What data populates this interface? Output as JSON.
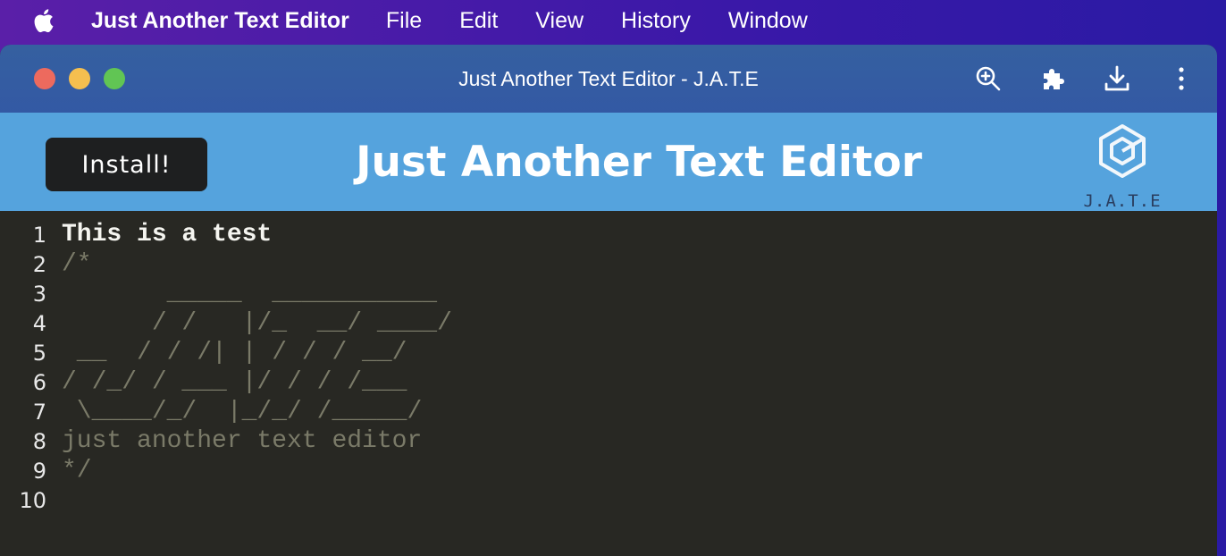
{
  "menubar": {
    "app_name": "Just Another Text Editor",
    "items": [
      "File",
      "Edit",
      "View",
      "History",
      "Window"
    ]
  },
  "window": {
    "title": "Just Another Text Editor - J.A.T.E",
    "toolbar_icons": [
      "zoom-in-icon",
      "extensions-icon",
      "download-icon",
      "more-vert-icon"
    ]
  },
  "header": {
    "install_label": "Install!",
    "title": "Just Another Text Editor",
    "logo_text": "J.A.T.E"
  },
  "editor": {
    "lines": [
      {
        "n": "1",
        "text": "This is a test"
      },
      {
        "n": "2",
        "text": "/*"
      },
      {
        "n": "3",
        "text": "       _____  ___________"
      },
      {
        "n": "4",
        "text": "      / /   |/_  __/ ____/"
      },
      {
        "n": "5",
        "text": " __  / / /| | / / / __/"
      },
      {
        "n": "6",
        "text": "/ /_/ / ___ |/ / / /___"
      },
      {
        "n": "7",
        "text": " \\____/_/  |_/_/ /_____/"
      },
      {
        "n": "8",
        "text": "just another text editor"
      },
      {
        "n": "9",
        "text": "*/"
      },
      {
        "n": "10",
        "text": ""
      }
    ]
  },
  "colors": {
    "header_bg": "#55a3dd",
    "titlebar_bg": "#3359a4",
    "editor_bg": "#282823",
    "comment": "#7a7a68"
  }
}
